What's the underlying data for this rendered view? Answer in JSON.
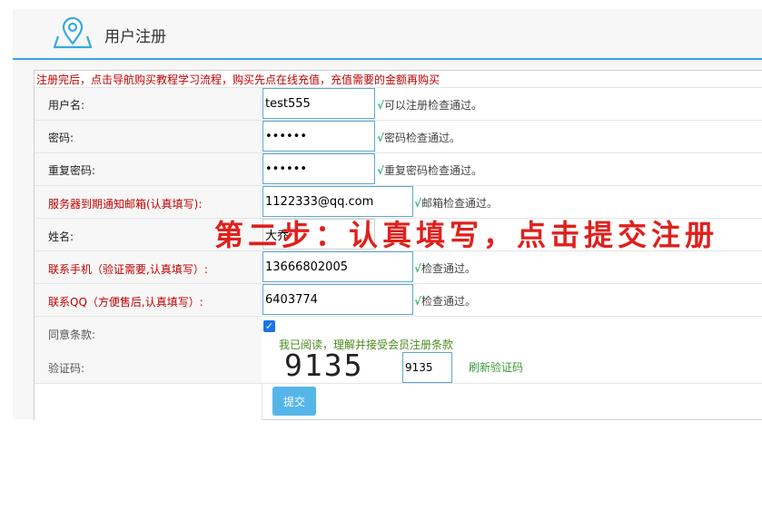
{
  "header": {
    "title": "用户注册",
    "icon": "map-pin-icon"
  },
  "notice": "注册完后，点击导航购买教程学习流程，购买先点在线充值，充值需要的金额再购买",
  "form": {
    "username": {
      "label": "用户名:",
      "value": "test555",
      "status": "可以注册检查通过。"
    },
    "password": {
      "label": "密码:",
      "value": "••••••",
      "status": "密码检查通过。"
    },
    "repeat_password": {
      "label": "重复密码:",
      "value": "••••••",
      "status": "重复密码检查通过。"
    },
    "email": {
      "label": "服务器到期通知邮箱(认真填写):",
      "value": "1122333@qq.com",
      "status": "邮箱检查通过。"
    },
    "name": {
      "label": "姓名:",
      "value": "大乔"
    },
    "phone": {
      "label": "联系手机（验证需要,认真填写）:",
      "value": "13666802005",
      "status": "检查通过。"
    },
    "qq": {
      "label": "联系QQ（方便售后,认真填写）:",
      "value": "6403774",
      "status": "检查通过。"
    },
    "agree": {
      "label": "同意条款:",
      "checked": true,
      "text": "我已阅读，理解并接受会员注册条款"
    },
    "captcha": {
      "label": "验证码:",
      "image_text": "9135",
      "value": "9135",
      "refresh_label": "刷新验证码"
    },
    "submit_label": "提交",
    "check_mark": "√"
  },
  "overlay_text": "第二步：认真填写，点击提交注册",
  "colors": {
    "accent": "#39a8e0",
    "required_label": "#c00000",
    "overlay": "#e0201c",
    "submit_bg": "#56b5e8"
  }
}
